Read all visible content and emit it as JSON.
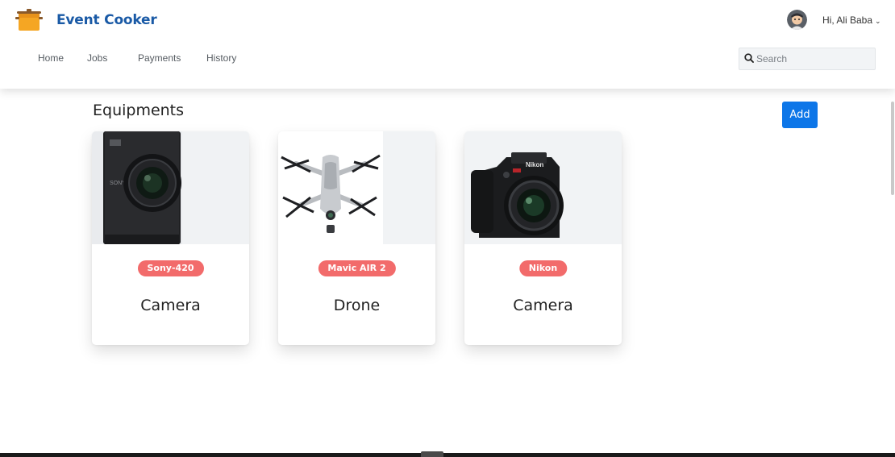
{
  "app": {
    "brand": "Event Cooker",
    "logo_icon": "pot-icon"
  },
  "nav": {
    "items": [
      {
        "label": "Home"
      },
      {
        "label": "Jobs"
      },
      {
        "label": "Payments"
      },
      {
        "label": "History"
      }
    ]
  },
  "user": {
    "greeting": "Hi, Ali Baba",
    "caret": "⌄",
    "avatar_icon": "user-avatar-icon"
  },
  "search": {
    "placeholder": "Search",
    "value": "",
    "icon": "search-icon"
  },
  "main": {
    "title": "Equipments",
    "add_label": "Add",
    "cards": [
      {
        "badge": "Sony-420",
        "title": "Camera",
        "image_icon": "compact-camera-image"
      },
      {
        "badge": "Mavic AIR 2",
        "title": "Drone",
        "image_icon": "drone-image"
      },
      {
        "badge": "Nikon",
        "title": "Camera",
        "image_icon": "dslr-camera-image"
      }
    ]
  },
  "colors": {
    "brand": "#1a5aa6",
    "primary_button": "#0d76e8",
    "badge": "#f26b6b"
  }
}
